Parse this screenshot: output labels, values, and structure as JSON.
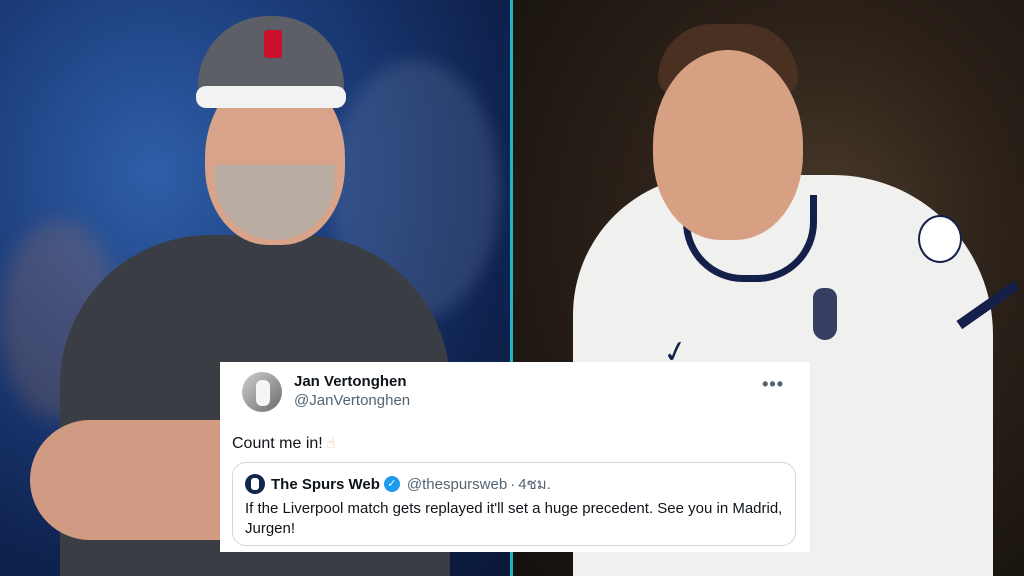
{
  "tweet": {
    "author_name": "Jan Vertonghen",
    "author_handle": "@JanVertonghen",
    "more_icon": "•••",
    "text": "Count me in!",
    "emoji": "☝",
    "quote": {
      "name": "The Spurs Web",
      "handle": "@thespursweb",
      "separator": "·",
      "time": "4ชม.",
      "text": "If the Liverpool match gets replayed it'll set a huge precedent.   See you in Madrid, Jurgen!"
    }
  },
  "colors": {
    "divider": "#1fb5c6",
    "verified": "#1d9bf0",
    "spurs_navy": "#15204a",
    "liverpool_red": "#c8102e"
  }
}
